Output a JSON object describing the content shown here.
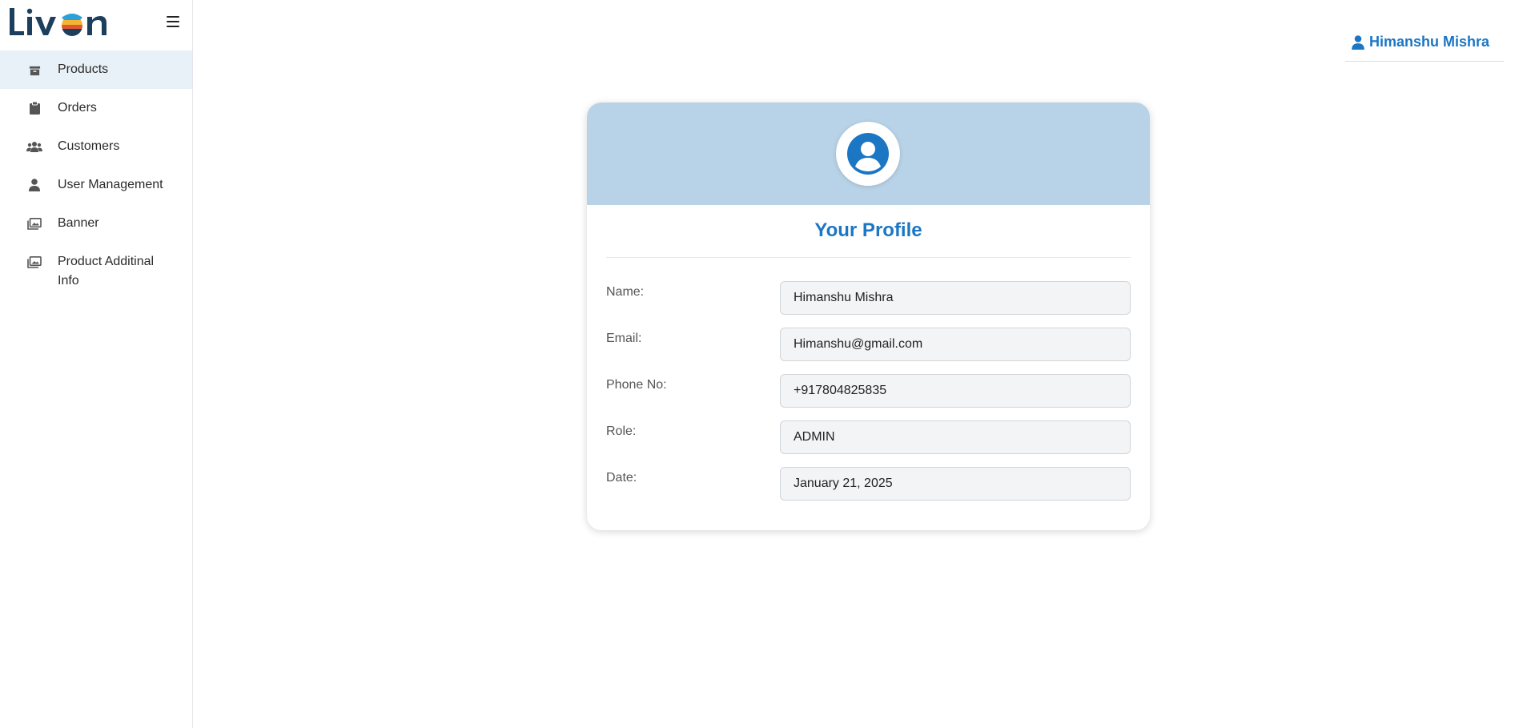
{
  "app": {
    "brand": "Livon"
  },
  "sidebar": {
    "items": [
      {
        "label": "Products",
        "icon": "box-icon",
        "active": true
      },
      {
        "label": "Orders",
        "icon": "clipboard-icon",
        "active": false
      },
      {
        "label": "Customers",
        "icon": "people-icon",
        "active": false
      },
      {
        "label": "User Management",
        "icon": "person-icon",
        "active": false
      },
      {
        "label": "Banner",
        "icon": "images-icon",
        "active": false
      },
      {
        "label": "Product Additinal Info",
        "icon": "images-icon",
        "active": false
      }
    ]
  },
  "header": {
    "user_name": "Himanshu Mishra"
  },
  "profile": {
    "title": "Your Profile",
    "fields": [
      {
        "label": "Name:",
        "value": "Himanshu Mishra"
      },
      {
        "label": "Email:",
        "value": "Himanshu@gmail.com"
      },
      {
        "label": "Phone No:",
        "value": "+917804825835"
      },
      {
        "label": "Role:",
        "value": "ADMIN"
      },
      {
        "label": "Date:",
        "value": "January 21, 2025"
      }
    ]
  },
  "colors": {
    "accent": "#1b76c4",
    "header_band": "#b8d3e8",
    "active_nav": "#e8f1f8"
  }
}
